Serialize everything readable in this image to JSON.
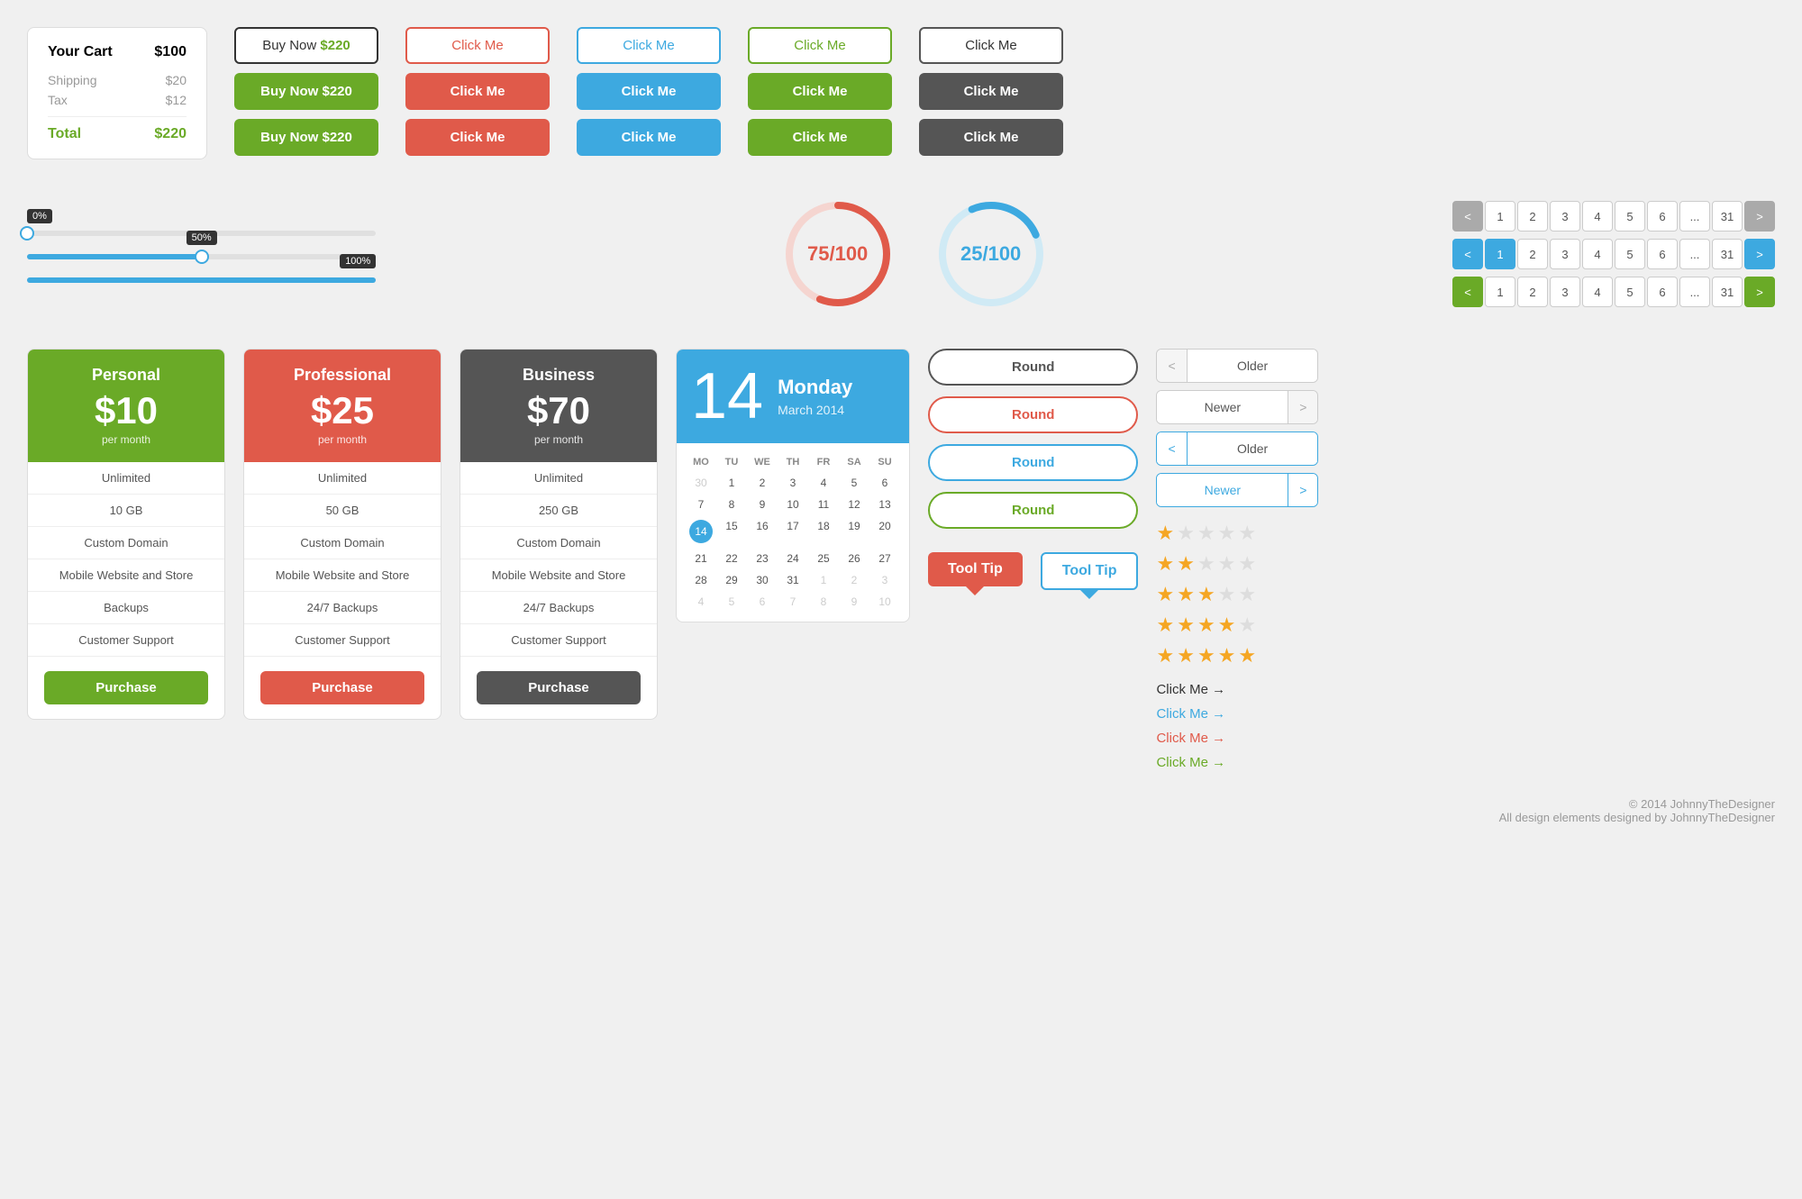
{
  "cart": {
    "title": "Your Cart",
    "amount": "$100",
    "shipping_label": "Shipping",
    "shipping_value": "$20",
    "tax_label": "Tax",
    "tax_value": "$12",
    "total_label": "Total",
    "total_value": "$220"
  },
  "buy_now": {
    "outline_label": "Buy Now",
    "outline_price": "$220",
    "green1_label": "Buy Now",
    "green1_price": "$220",
    "green2_label": "Buy Now",
    "green2_price": "$220"
  },
  "buttons": {
    "click_me": "Click Me",
    "purchase": "Purchase",
    "older": "Older",
    "newer": "Newer"
  },
  "sliders": {
    "val0": "0%",
    "val50": "50%",
    "val100": "100%"
  },
  "circles": {
    "red_value": "75/100",
    "blue_value": "25/100"
  },
  "pagination": {
    "pages": [
      "1",
      "2",
      "3",
      "4",
      "5",
      "6",
      "...",
      "31"
    ],
    "prev": "<",
    "next": ">"
  },
  "pricing": {
    "personal": {
      "title": "Personal",
      "price": "$10",
      "period": "per month",
      "features": [
        "Unlimited",
        "10 GB",
        "Custom Domain",
        "Mobile Website and Store",
        "Backups",
        "Customer Support"
      ],
      "btn": "Purchase"
    },
    "professional": {
      "title": "Professional",
      "price": "$25",
      "period": "per month",
      "features": [
        "Unlimited",
        "50 GB",
        "Custom Domain",
        "Mobile Website and Store",
        "24/7 Backups",
        "Customer Support"
      ],
      "btn": "Purchase"
    },
    "business": {
      "title": "Business",
      "price": "$70",
      "period": "per month",
      "features": [
        "Unlimited",
        "250 GB",
        "Custom Domain",
        "Mobile Website and Store",
        "24/7 Backups",
        "Customer Support"
      ],
      "btn": "Purchase"
    }
  },
  "calendar": {
    "day": "14",
    "day_name": "Monday",
    "month_year": "March 2014",
    "headers": [
      "MO",
      "TU",
      "WE",
      "TH",
      "FR",
      "SA",
      "SU"
    ],
    "weeks": [
      [
        "30",
        "1",
        "2",
        "3",
        "4",
        "5",
        "6"
      ],
      [
        "7",
        "8",
        "9",
        "10",
        "11",
        "12",
        "13"
      ],
      [
        "14",
        "15",
        "16",
        "17",
        "18",
        "19",
        "20"
      ],
      [
        "21",
        "22",
        "23",
        "24",
        "25",
        "26",
        "27"
      ],
      [
        "28",
        "29",
        "30",
        "31",
        "1",
        "2",
        "3"
      ],
      [
        "4",
        "5",
        "6",
        "7",
        "8",
        "9",
        "10"
      ]
    ],
    "today": "14"
  },
  "round_buttons": {
    "labels": [
      "Round",
      "Round",
      "Round",
      "Round"
    ]
  },
  "nav_buttons": {
    "older1": "Older",
    "newer1": "Newer",
    "older2": "Older",
    "newer2": "Newer"
  },
  "tooltips": {
    "label1": "Tool Tip",
    "label2": "Tool Tip"
  },
  "stars": {
    "rows": [
      1,
      2,
      3,
      4
    ]
  },
  "click_links": {
    "items": [
      {
        "label": "Click Me →",
        "color": "dark"
      },
      {
        "label": "Click Me →",
        "color": "blue"
      },
      {
        "label": "Click Me →",
        "color": "orange"
      },
      {
        "label": "Click Me →",
        "color": "green"
      }
    ]
  },
  "footer": {
    "line1": "© 2014 JohnnyTheDesigner",
    "line2": "All design elements designed by JohnnyTheDesigner"
  }
}
